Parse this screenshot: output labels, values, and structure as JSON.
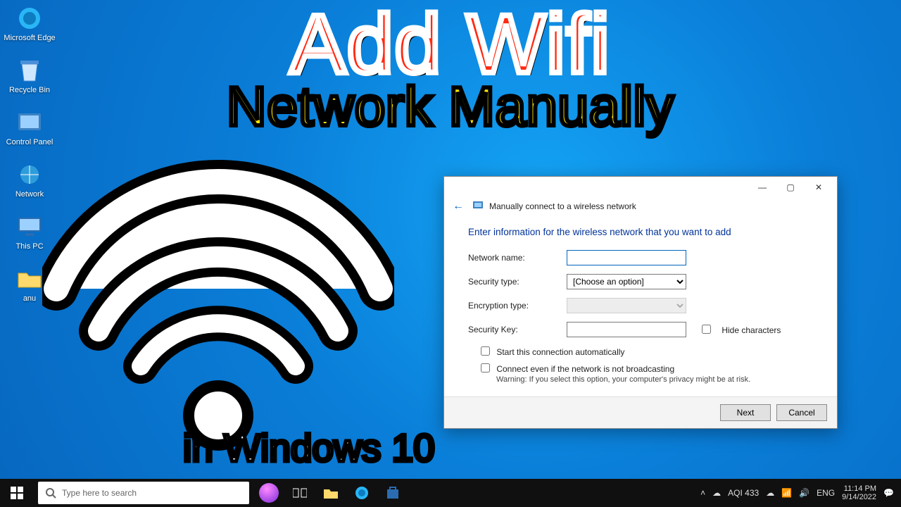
{
  "overlay": {
    "title_line1": "Add Wifi",
    "title_line2": "Network Manually",
    "subtitle": "in Windows 10"
  },
  "desktop_icons": [
    {
      "name": "edge",
      "label": "Microsoft Edge"
    },
    {
      "name": "recycle-bin",
      "label": "Recycle Bin"
    },
    {
      "name": "control-panel",
      "label": "Control Panel"
    },
    {
      "name": "network",
      "label": "Network"
    },
    {
      "name": "this-pc",
      "label": "This PC"
    },
    {
      "name": "anu",
      "label": "anu"
    }
  ],
  "dialog": {
    "window_title": "Manually connect to a wireless network",
    "heading": "Enter information for the wireless network that you want to add",
    "fields": {
      "network_name_label": "Network name:",
      "network_name_value": "",
      "security_type_label": "Security type:",
      "security_type_value": "[Choose an option]",
      "encryption_type_label": "Encryption type:",
      "encryption_type_value": "",
      "security_key_label": "Security Key:",
      "security_key_value": "",
      "hide_characters_label": "Hide characters",
      "start_auto_label": "Start this connection automatically",
      "connect_not_broadcast_label": "Connect even if the network is not broadcasting",
      "warning": "Warning: If you select this option, your computer's privacy might be at risk."
    },
    "buttons": {
      "next": "Next",
      "cancel": "Cancel"
    }
  },
  "taskbar": {
    "search_placeholder": "Type here to search",
    "aqi": "AQI 433",
    "lang": "ENG",
    "time": "11:14 PM",
    "date": "9/14/2022"
  }
}
